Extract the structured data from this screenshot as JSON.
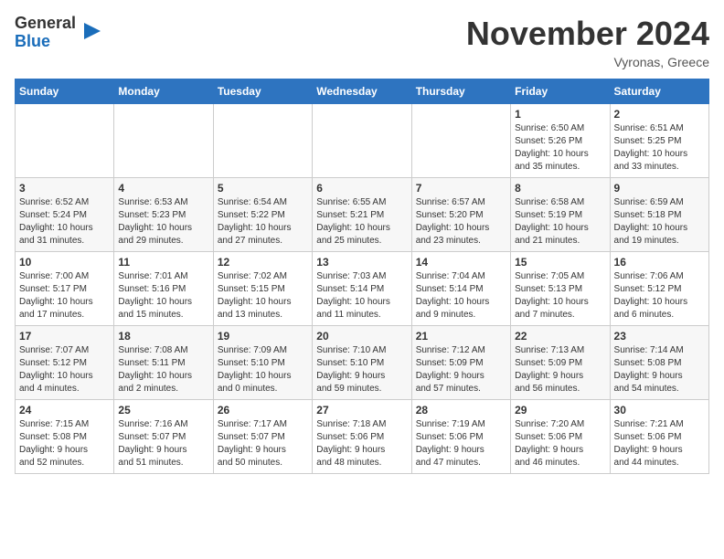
{
  "logo": {
    "line1": "General",
    "line2": "Blue"
  },
  "header": {
    "month": "November 2024",
    "location": "Vyronas, Greece"
  },
  "days_of_week": [
    "Sunday",
    "Monday",
    "Tuesday",
    "Wednesday",
    "Thursday",
    "Friday",
    "Saturday"
  ],
  "weeks": [
    [
      {
        "day": "",
        "info": ""
      },
      {
        "day": "",
        "info": ""
      },
      {
        "day": "",
        "info": ""
      },
      {
        "day": "",
        "info": ""
      },
      {
        "day": "",
        "info": ""
      },
      {
        "day": "1",
        "info": "Sunrise: 6:50 AM\nSunset: 5:26 PM\nDaylight: 10 hours\nand 35 minutes."
      },
      {
        "day": "2",
        "info": "Sunrise: 6:51 AM\nSunset: 5:25 PM\nDaylight: 10 hours\nand 33 minutes."
      }
    ],
    [
      {
        "day": "3",
        "info": "Sunrise: 6:52 AM\nSunset: 5:24 PM\nDaylight: 10 hours\nand 31 minutes."
      },
      {
        "day": "4",
        "info": "Sunrise: 6:53 AM\nSunset: 5:23 PM\nDaylight: 10 hours\nand 29 minutes."
      },
      {
        "day": "5",
        "info": "Sunrise: 6:54 AM\nSunset: 5:22 PM\nDaylight: 10 hours\nand 27 minutes."
      },
      {
        "day": "6",
        "info": "Sunrise: 6:55 AM\nSunset: 5:21 PM\nDaylight: 10 hours\nand 25 minutes."
      },
      {
        "day": "7",
        "info": "Sunrise: 6:57 AM\nSunset: 5:20 PM\nDaylight: 10 hours\nand 23 minutes."
      },
      {
        "day": "8",
        "info": "Sunrise: 6:58 AM\nSunset: 5:19 PM\nDaylight: 10 hours\nand 21 minutes."
      },
      {
        "day": "9",
        "info": "Sunrise: 6:59 AM\nSunset: 5:18 PM\nDaylight: 10 hours\nand 19 minutes."
      }
    ],
    [
      {
        "day": "10",
        "info": "Sunrise: 7:00 AM\nSunset: 5:17 PM\nDaylight: 10 hours\nand 17 minutes."
      },
      {
        "day": "11",
        "info": "Sunrise: 7:01 AM\nSunset: 5:16 PM\nDaylight: 10 hours\nand 15 minutes."
      },
      {
        "day": "12",
        "info": "Sunrise: 7:02 AM\nSunset: 5:15 PM\nDaylight: 10 hours\nand 13 minutes."
      },
      {
        "day": "13",
        "info": "Sunrise: 7:03 AM\nSunset: 5:14 PM\nDaylight: 10 hours\nand 11 minutes."
      },
      {
        "day": "14",
        "info": "Sunrise: 7:04 AM\nSunset: 5:14 PM\nDaylight: 10 hours\nand 9 minutes."
      },
      {
        "day": "15",
        "info": "Sunrise: 7:05 AM\nSunset: 5:13 PM\nDaylight: 10 hours\nand 7 minutes."
      },
      {
        "day": "16",
        "info": "Sunrise: 7:06 AM\nSunset: 5:12 PM\nDaylight: 10 hours\nand 6 minutes."
      }
    ],
    [
      {
        "day": "17",
        "info": "Sunrise: 7:07 AM\nSunset: 5:12 PM\nDaylight: 10 hours\nand 4 minutes."
      },
      {
        "day": "18",
        "info": "Sunrise: 7:08 AM\nSunset: 5:11 PM\nDaylight: 10 hours\nand 2 minutes."
      },
      {
        "day": "19",
        "info": "Sunrise: 7:09 AM\nSunset: 5:10 PM\nDaylight: 10 hours\nand 0 minutes."
      },
      {
        "day": "20",
        "info": "Sunrise: 7:10 AM\nSunset: 5:10 PM\nDaylight: 9 hours\nand 59 minutes."
      },
      {
        "day": "21",
        "info": "Sunrise: 7:12 AM\nSunset: 5:09 PM\nDaylight: 9 hours\nand 57 minutes."
      },
      {
        "day": "22",
        "info": "Sunrise: 7:13 AM\nSunset: 5:09 PM\nDaylight: 9 hours\nand 56 minutes."
      },
      {
        "day": "23",
        "info": "Sunrise: 7:14 AM\nSunset: 5:08 PM\nDaylight: 9 hours\nand 54 minutes."
      }
    ],
    [
      {
        "day": "24",
        "info": "Sunrise: 7:15 AM\nSunset: 5:08 PM\nDaylight: 9 hours\nand 52 minutes."
      },
      {
        "day": "25",
        "info": "Sunrise: 7:16 AM\nSunset: 5:07 PM\nDaylight: 9 hours\nand 51 minutes."
      },
      {
        "day": "26",
        "info": "Sunrise: 7:17 AM\nSunset: 5:07 PM\nDaylight: 9 hours\nand 50 minutes."
      },
      {
        "day": "27",
        "info": "Sunrise: 7:18 AM\nSunset: 5:06 PM\nDaylight: 9 hours\nand 48 minutes."
      },
      {
        "day": "28",
        "info": "Sunrise: 7:19 AM\nSunset: 5:06 PM\nDaylight: 9 hours\nand 47 minutes."
      },
      {
        "day": "29",
        "info": "Sunrise: 7:20 AM\nSunset: 5:06 PM\nDaylight: 9 hours\nand 46 minutes."
      },
      {
        "day": "30",
        "info": "Sunrise: 7:21 AM\nSunset: 5:06 PM\nDaylight: 9 hours\nand 44 minutes."
      }
    ]
  ]
}
